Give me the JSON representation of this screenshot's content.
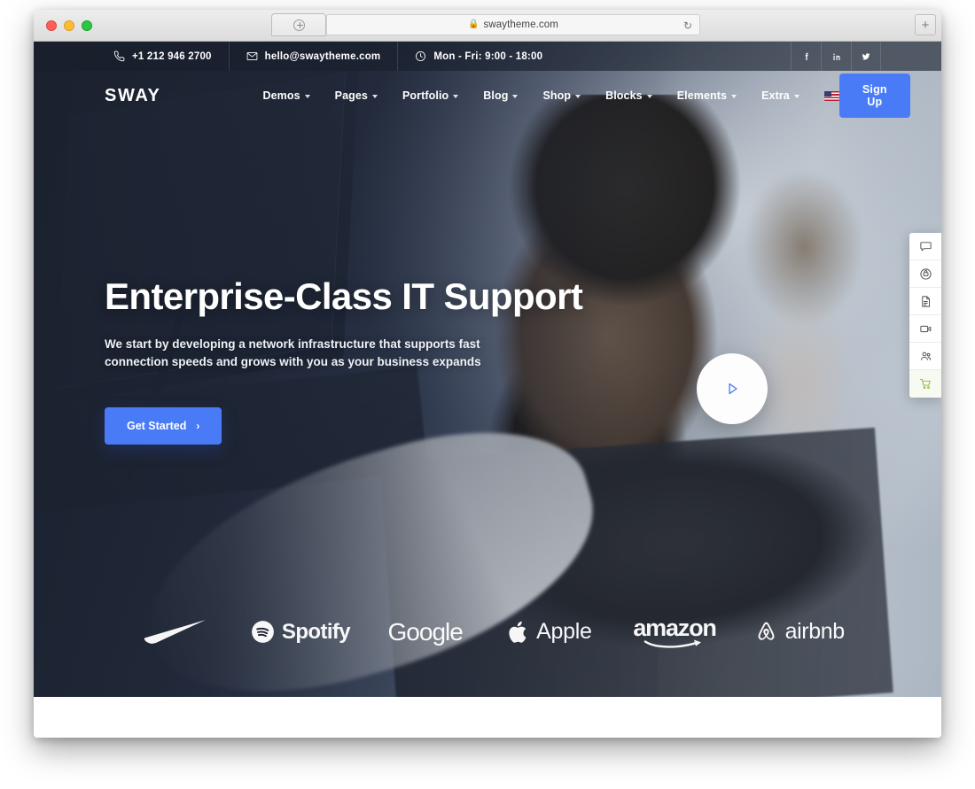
{
  "browser": {
    "url": "swaytheme.com",
    "lock_icon": "lock-icon",
    "reload_icon": "reload-icon",
    "new_tab_icon": "plus-icon",
    "tab_icon": "circle-plus-icon",
    "traffic_lights": [
      "close",
      "minimize",
      "zoom"
    ]
  },
  "topbar": {
    "items": [
      {
        "icon": "phone-icon",
        "label": "+1 212 946 2700"
      },
      {
        "icon": "envelope-icon",
        "label": "hello@swaytheme.com"
      },
      {
        "icon": "clock-icon",
        "label": "Mon - Fri: 9:00 - 18:00"
      }
    ],
    "social": [
      {
        "icon": "facebook-icon",
        "name": "Facebook"
      },
      {
        "icon": "linkedin-icon",
        "name": "LinkedIn"
      },
      {
        "icon": "twitter-icon",
        "name": "Twitter"
      }
    ],
    "background": "#181f2c"
  },
  "nav": {
    "brand": "SWAY",
    "menu": [
      {
        "label": "Demos",
        "has_dropdown": true
      },
      {
        "label": "Pages",
        "has_dropdown": true
      },
      {
        "label": "Portfolio",
        "has_dropdown": true
      },
      {
        "label": "Blog",
        "has_dropdown": true
      },
      {
        "label": "Shop",
        "has_dropdown": true
      },
      {
        "label": "Blocks",
        "has_dropdown": true
      },
      {
        "label": "Elements",
        "has_dropdown": true
      },
      {
        "label": "Extra",
        "has_dropdown": true
      }
    ],
    "language_flag": "us-flag-icon",
    "signup_label": "Sign Up",
    "accent_color": "#4a7bf7"
  },
  "hero": {
    "title": "Enterprise-Class IT Support",
    "subtitle": "We start by developing a network infrastructure that supports fast connection speeds and grows with you as your business expands",
    "cta_label": "Get Started",
    "cta_chevron": "›",
    "play_button_icon": "play-icon",
    "play_button_color": "#4a7bf7"
  },
  "brands": [
    {
      "name": "Nike",
      "label": "",
      "icon": "nike-swoosh-icon"
    },
    {
      "name": "Spotify",
      "label": "Spotify",
      "icon": "spotify-icon"
    },
    {
      "name": "Google",
      "label": "Google",
      "icon": ""
    },
    {
      "name": "Apple",
      "label": "Apple",
      "icon": "apple-icon"
    },
    {
      "name": "Amazon",
      "label": "amazon",
      "icon": "amazon-smile-icon"
    },
    {
      "name": "Airbnb",
      "label": "airbnb",
      "icon": "airbnb-icon"
    }
  ],
  "side_toolbar": {
    "items": [
      {
        "icon": "chat-bubble-icon",
        "name": "chat"
      },
      {
        "icon": "support-headset-icon",
        "name": "support"
      },
      {
        "icon": "document-icon",
        "name": "document"
      },
      {
        "icon": "video-camera-icon",
        "name": "video"
      },
      {
        "icon": "users-icon",
        "name": "users"
      },
      {
        "icon": "shopping-cart-icon",
        "name": "cart"
      }
    ],
    "cart_color": "#8ab33a"
  }
}
